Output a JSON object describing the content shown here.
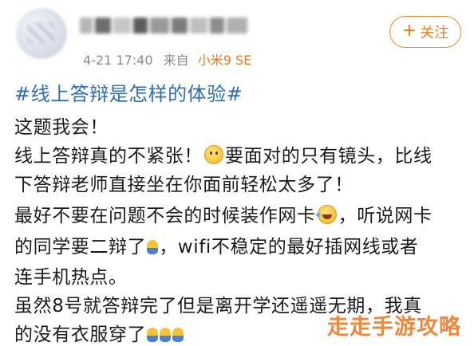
{
  "post": {
    "timestamp": "4-21 17:40",
    "source_prefix": "来自",
    "device": "小米9 SE",
    "follow_button": {
      "plus": "+",
      "label": "关注"
    },
    "topic": "#线上答辩是怎样的体验#",
    "lines": [
      "这题我会！",
      "线上答辩真的不紧张！",
      "要面对的只有镜头，比线",
      "下答辩老师直接坐在你面前轻松太多了！",
      "最好不要在问题不会的时候装作网卡",
      "，听说网卡",
      "的同学要二辩了",
      "，wifi不稳定的最好插网线或者",
      "连手机热点。",
      "虽然8号就答辩完了但是离开学还遥遥无期，我真",
      "的没有衣服穿了"
    ]
  },
  "watermark": "走走手游攻略",
  "colors": {
    "accent": "#ef7b1a",
    "topic": "#2e6db3",
    "meta": "#8c8c8c"
  },
  "icons": [
    "smile-emoji-icon",
    "laugh-cry-emoji-icon",
    "tiny-figure-emoji-icon"
  ]
}
